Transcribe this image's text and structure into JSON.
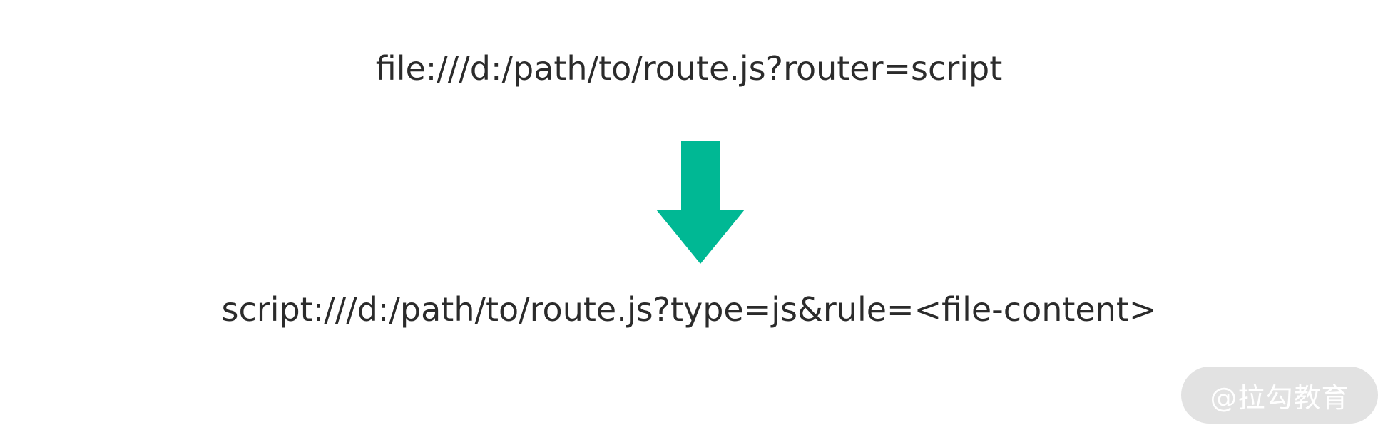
{
  "source_url": "file:///d:/path/to/route.js?router=script",
  "target_url": "script:///d:/path/to/route.js?type=js&rule=<file-content>",
  "arrow": {
    "direction": "down",
    "color": "#00b894"
  },
  "watermark": {
    "text": "@拉勾教育"
  }
}
